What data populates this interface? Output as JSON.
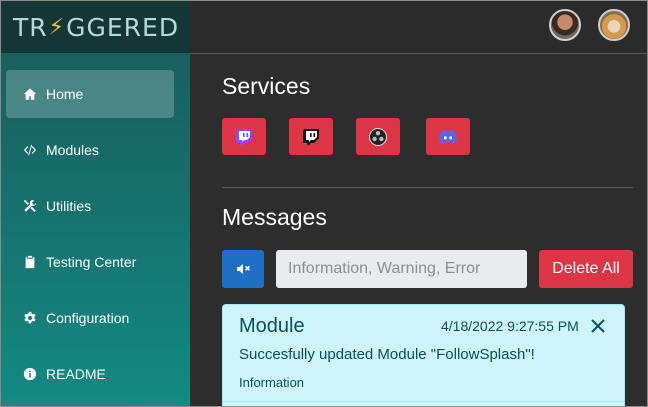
{
  "app": {
    "logo_text_start": "TR",
    "logo_bolt": "⚡",
    "logo_text_end": "GGERED"
  },
  "sidebar": {
    "items": [
      {
        "label": "Home",
        "icon": "home-icon",
        "active": true
      },
      {
        "label": "Modules",
        "icon": "code-icon",
        "active": false
      },
      {
        "label": "Utilities",
        "icon": "tools-icon",
        "active": false
      },
      {
        "label": "Testing Center",
        "icon": "clipboard-icon",
        "active": false
      },
      {
        "label": "Configuration",
        "icon": "gear-icon",
        "active": false
      },
      {
        "label": "README",
        "icon": "info-icon",
        "active": false
      }
    ]
  },
  "header": {
    "avatars": [
      "user-avatar-1",
      "user-avatar-2"
    ]
  },
  "services": {
    "title": "Services",
    "buttons": [
      {
        "name": "twitch-bot",
        "icon": "twitch-purple-icon"
      },
      {
        "name": "twitch-broadcaster",
        "icon": "twitch-white-icon"
      },
      {
        "name": "obs",
        "icon": "obs-icon"
      },
      {
        "name": "discord",
        "icon": "discord-icon"
      }
    ]
  },
  "messages": {
    "title": "Messages",
    "mute_icon": "volume-mute-icon",
    "filter_placeholder": "Information, Warning, Error",
    "delete_all_label": "Delete All",
    "items": [
      {
        "source": "Module",
        "timestamp": "4/18/2022 9:27:55 PM",
        "text": "Succesfully updated Module \"FollowSplash\"!",
        "level": "Information"
      }
    ]
  },
  "colors": {
    "accent_red": "#dc3545",
    "accent_blue": "#1f6fc5",
    "sidebar_teal": "#176e6a",
    "info_bg": "#cff4fc",
    "info_text": "#055160"
  }
}
